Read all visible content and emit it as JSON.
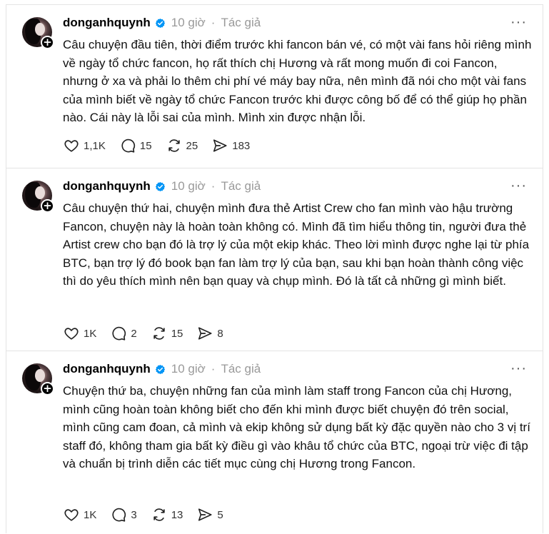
{
  "posts": [
    {
      "username": "donganhquynh",
      "time": "10 giờ",
      "separator": "·",
      "tag": "Tác giả",
      "more": "···",
      "text": "Câu chuyện đầu tiên, thời điểm trước khi fancon bán vé, có một vài fans hỏi riêng mình về ngày tổ chức fancon, họ rất thích chị Hương và rất mong muốn đi coi Fancon, nhưng ở xa và phải lo thêm chi phí vé máy bay nữa, nên mình đã nói cho một vài fans của mình biết về ngày tổ chức Fancon trước khi được công bố để có thể giúp họ phần nào. Cái này là lỗi sai của mình. Mình xin được nhận lỗi.",
      "likes": "1,1K",
      "comments": "15",
      "reposts": "25",
      "shares": "183"
    },
    {
      "username": "donganhquynh",
      "time": "10 giờ",
      "separator": "·",
      "tag": "Tác giả",
      "more": "···",
      "text": "Câu chuyện thứ hai, chuyện mình đưa thẻ Artist Crew cho fan mình vào hậu trường Fancon, chuyện này là hoàn toàn không có. Mình đã tìm hiểu thông tin, người đưa thẻ Artist crew cho bạn đó là trợ lý của một ekip khác. Theo lời mình được nghe lại từ phía BTC, bạn trợ lý đó book bạn fan làm trợ lý của bạn, sau khi bạn hoàn thành công việc thì do yêu thích mình nên bạn quay và chụp mình. Đó là tất cả những gì mình biết.",
      "likes": "1K",
      "comments": "2",
      "reposts": "15",
      "shares": "8"
    },
    {
      "username": "donganhquynh",
      "time": "10 giờ",
      "separator": "·",
      "tag": "Tác giả",
      "more": "···",
      "text": "Chuyện thứ ba, chuyện những fan của mình làm staff trong Fancon của chị Hương, mình cũng hoàn toàn không biết cho đến khi mình được biết chuyện đó trên social, mình cũng cam đoan, cả mình và ekip không sử dụng bất kỳ đặc quyền nào cho 3 vị trí staff đó, không tham gia bất kỳ điều gì vào khâu tổ chức của BTC, ngoại trừ việc đi tập và chuẩn bị trình diễn các tiết mục cùng chị Hương trong Fancon.",
      "likes": "1K",
      "comments": "3",
      "reposts": "13",
      "shares": "5"
    }
  ],
  "icons": {
    "verified": "verified-badge-icon",
    "like": "heart-icon",
    "comment": "comment-bubble-icon",
    "repost": "repost-icon",
    "share": "send-icon",
    "more": "more-options-icon",
    "follow": "plus-follow-icon"
  },
  "colors": {
    "verified": "#0095f6",
    "muted": "#999999",
    "text": "#111111",
    "divider": "#e4e4e4"
  }
}
